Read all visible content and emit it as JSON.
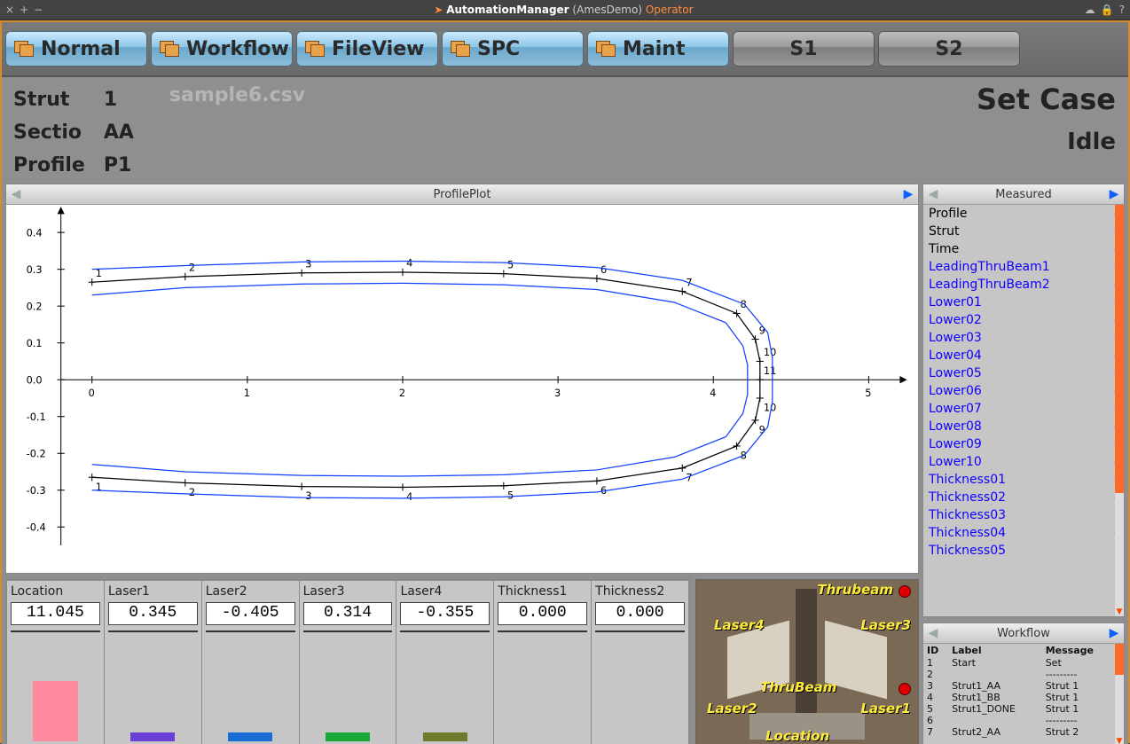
{
  "title_bar": {
    "app": "AutomationManager",
    "context": "(AmesDemo)",
    "role": "Operator",
    "sys_left": [
      "×",
      "+",
      "−"
    ],
    "sys_right": [
      "☁",
      "🔒",
      "?"
    ]
  },
  "tabs": [
    {
      "label": "Normal",
      "kind": "blue"
    },
    {
      "label": "Workflow",
      "kind": "blue"
    },
    {
      "label": "FileView",
      "kind": "blue"
    },
    {
      "label": "SPC",
      "kind": "blue"
    },
    {
      "label": "Maint",
      "kind": "blue"
    },
    {
      "label": "S1",
      "kind": "grey"
    },
    {
      "label": "S2",
      "kind": "grey"
    }
  ],
  "info": {
    "rows": [
      {
        "k": "Strut",
        "v": "1"
      },
      {
        "k": "Sectio",
        "v": "AA"
      },
      {
        "k": "Profile",
        "v": "P1"
      }
    ],
    "file": "sample6.csv",
    "set_case": "Set Case",
    "state": "Idle"
  },
  "plot_panel_title": "ProfilePlot",
  "chart_data": {
    "type": "line",
    "title": "ProfilePlot",
    "xlabel": "",
    "ylabel": "",
    "xlim": [
      -0.2,
      5.2
    ],
    "ylim": [
      -0.45,
      0.45
    ],
    "xticks": [
      0,
      1,
      2,
      3,
      4,
      5
    ],
    "yticks": [
      -0.4,
      -0.3,
      -0.2,
      -0.1,
      -0.0,
      0.1,
      0.2,
      0.3,
      0.4
    ],
    "point_labels": [
      "1",
      "2",
      "3",
      "4",
      "5",
      "6",
      "7",
      "8",
      "9",
      "10",
      "11",
      "10",
      "9",
      "8",
      "7",
      "6",
      "5",
      "4",
      "3",
      "2",
      "1"
    ],
    "series": [
      {
        "name": "nominal",
        "color": "#000",
        "marker": true,
        "x": [
          0.0,
          0.6,
          1.35,
          2.0,
          2.65,
          3.25,
          3.8,
          4.15,
          4.27,
          4.3,
          4.3,
          4.3,
          4.27,
          4.15,
          3.8,
          3.25,
          2.65,
          2.0,
          1.35,
          0.6,
          0.0
        ],
        "y": [
          0.265,
          0.28,
          0.29,
          0.292,
          0.288,
          0.275,
          0.24,
          0.18,
          0.11,
          0.05,
          0.0,
          -0.05,
          -0.11,
          -0.18,
          -0.24,
          -0.275,
          -0.288,
          -0.292,
          -0.29,
          -0.28,
          -0.265
        ]
      },
      {
        "name": "upper_tol",
        "color": "#1040ff",
        "marker": false,
        "x": [
          0.0,
          0.6,
          1.35,
          2.0,
          2.65,
          3.25,
          3.8,
          4.2,
          4.35,
          4.38,
          4.38,
          4.38,
          4.35,
          4.2,
          3.8,
          3.25,
          2.65,
          2.0,
          1.35,
          0.6,
          0.0
        ],
        "y": [
          0.3,
          0.31,
          0.32,
          0.322,
          0.318,
          0.305,
          0.27,
          0.205,
          0.128,
          0.06,
          0.0,
          -0.06,
          -0.128,
          -0.205,
          -0.27,
          -0.305,
          -0.318,
          -0.322,
          -0.32,
          -0.31,
          -0.3
        ]
      },
      {
        "name": "lower_tol",
        "color": "#1040ff",
        "marker": false,
        "x": [
          0.0,
          0.6,
          1.35,
          2.0,
          2.65,
          3.25,
          3.75,
          4.08,
          4.19,
          4.22,
          4.22,
          4.22,
          4.19,
          4.08,
          3.75,
          3.25,
          2.65,
          2.0,
          1.35,
          0.6,
          0.0
        ],
        "y": [
          0.23,
          0.25,
          0.26,
          0.262,
          0.258,
          0.245,
          0.21,
          0.155,
          0.092,
          0.04,
          0.0,
          -0.04,
          -0.092,
          -0.155,
          -0.21,
          -0.245,
          -0.258,
          -0.262,
          -0.26,
          -0.25,
          -0.23
        ]
      }
    ]
  },
  "gauges": [
    {
      "label": "Location",
      "value": "11.045",
      "bar": 0.55,
      "color": "#ff8aa0"
    },
    {
      "label": "Laser1",
      "value": "0.345",
      "bar": 0.08,
      "color": "#6a3fd6"
    },
    {
      "label": "Laser2",
      "value": "-0.405",
      "bar": 0.08,
      "color": "#1b6dd6"
    },
    {
      "label": "Laser3",
      "value": "0.314",
      "bar": 0.08,
      "color": "#1aa836"
    },
    {
      "label": "Laser4",
      "value": "-0.355",
      "bar": 0.08,
      "color": "#6f7a2d"
    },
    {
      "label": "Thickness1",
      "value": "0.000",
      "bar": 0.0,
      "color": "#888"
    },
    {
      "label": "Thickness2",
      "value": "0.000",
      "bar": 0.0,
      "color": "#888"
    }
  ],
  "camera_labels": {
    "thrubeam_top": "Thrubeam",
    "laser4": "Laser4",
    "laser3": "Laser3",
    "thrubeam_mid": "ThruBeam",
    "laser2": "Laser2",
    "laser1": "Laser1",
    "location": "Location"
  },
  "measured": {
    "title": "Measured",
    "rows": [
      {
        "k": "Profile",
        "v": "-",
        "blue": false
      },
      {
        "k": "Strut",
        "v": "-",
        "blue": false
      },
      {
        "k": "Time",
        "v": "-",
        "blue": false
      },
      {
        "k": "LeadingThruBeam1",
        "v": "-",
        "blue": true
      },
      {
        "k": "LeadingThruBeam2",
        "v": "-",
        "blue": true
      },
      {
        "k": "Lower01",
        "v": "-",
        "blue": true
      },
      {
        "k": "Lower02",
        "v": "-",
        "blue": true
      },
      {
        "k": "Lower03",
        "v": "-",
        "blue": true
      },
      {
        "k": "Lower04",
        "v": "-",
        "blue": true
      },
      {
        "k": "Lower05",
        "v": "-",
        "blue": true
      },
      {
        "k": "Lower06",
        "v": "-",
        "blue": true
      },
      {
        "k": "Lower07",
        "v": "-",
        "blue": true
      },
      {
        "k": "Lower08",
        "v": "-",
        "blue": true
      },
      {
        "k": "Lower09",
        "v": "-",
        "blue": true
      },
      {
        "k": "Lower10",
        "v": "-",
        "blue": true
      },
      {
        "k": "Thickness01",
        "v": "-",
        "blue": true
      },
      {
        "k": "Thickness02",
        "v": "-",
        "blue": true
      },
      {
        "k": "Thickness03",
        "v": "-",
        "blue": true
      },
      {
        "k": "Thickness04",
        "v": "-",
        "blue": true
      },
      {
        "k": "Thickness05",
        "v": "-",
        "blue": true
      }
    ]
  },
  "workflow": {
    "title": "Workflow",
    "columns": [
      "ID",
      "Label",
      "Message"
    ],
    "rows": [
      {
        "id": "1",
        "label": "Start",
        "msg": "Set"
      },
      {
        "id": "2",
        "label": "",
        "msg": "---------"
      },
      {
        "id": "3",
        "label": "Strut1_AA",
        "msg": "Strut 1"
      },
      {
        "id": "4",
        "label": "Strut1_BB",
        "msg": "Strut 1"
      },
      {
        "id": "5",
        "label": "Strut1_DONE",
        "msg": "Strut 1"
      },
      {
        "id": "6",
        "label": "",
        "msg": "---------"
      },
      {
        "id": "7",
        "label": "Strut2_AA",
        "msg": "Strut 2"
      }
    ]
  }
}
